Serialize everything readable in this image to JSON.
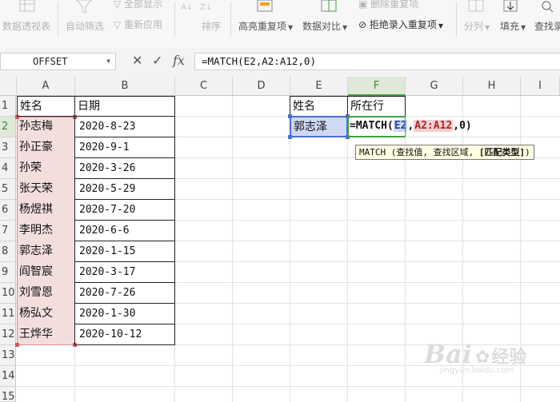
{
  "ribbon": {
    "pivot": "数据透视表",
    "autofilter": "自动筛选",
    "showall": "全部显示",
    "reapply": "重新应用",
    "sort": "排序",
    "highlight_dup": "高亮重复项",
    "compare": "数据对比",
    "delete_dup": "删除重复项",
    "reject_dup": "拒绝录入重复项",
    "split": "分列",
    "fill": "填充",
    "lookup": "查找录"
  },
  "formula_bar": {
    "name_box": "OFFSET",
    "cancel_icon": "✕",
    "confirm_icon": "✓",
    "fx_label": "fx",
    "formula": "=MATCH(E2,A2:A12,0)"
  },
  "columns": [
    "A",
    "B",
    "C",
    "D",
    "E",
    "F",
    "G",
    "H",
    "I"
  ],
  "rows": [
    "1",
    "2",
    "3",
    "4",
    "5",
    "6",
    "7",
    "8",
    "9",
    "10",
    "11",
    "12",
    "13",
    "14",
    "15"
  ],
  "sheet": {
    "a1": "姓名",
    "b1": "日期",
    "e1": "姓名",
    "f1": "所在行",
    "e2": "郭志泽",
    "edit": {
      "prefix": "=MATCH(",
      "ref1": "E2",
      "sep1": ",",
      "ref2": "A2:A12",
      "suffix": ",0)"
    },
    "names": [
      "孙志梅",
      "孙正豪",
      "孙荣",
      "张天荣",
      "杨煜祺",
      "李明杰",
      "郭志泽",
      "阎智宸",
      "刘雪恩",
      "杨弘文",
      "王烨华"
    ],
    "dates": [
      "2020-8-23",
      "2020-9-1",
      "2020-3-26",
      "2020-5-29",
      "2020-7-20",
      "2020-6-6",
      "2020-1-15",
      "2020-3-17",
      "2020-7-26",
      "2020-1-30",
      "2020-10-12"
    ]
  },
  "tooltip": {
    "text": "MATCH (查找值, 查找区域, ",
    "bold": "[匹配类型]",
    "end": ")"
  },
  "watermark": {
    "text": "Bai",
    "suffix": "经验",
    "domain": "jingyan.baidu.com"
  },
  "colors": {
    "active_header": "#3fa13f",
    "range_fill": "#f3dede",
    "ref_blue": "#4a6fd1",
    "tooltip_bg": "#ffffe1"
  }
}
